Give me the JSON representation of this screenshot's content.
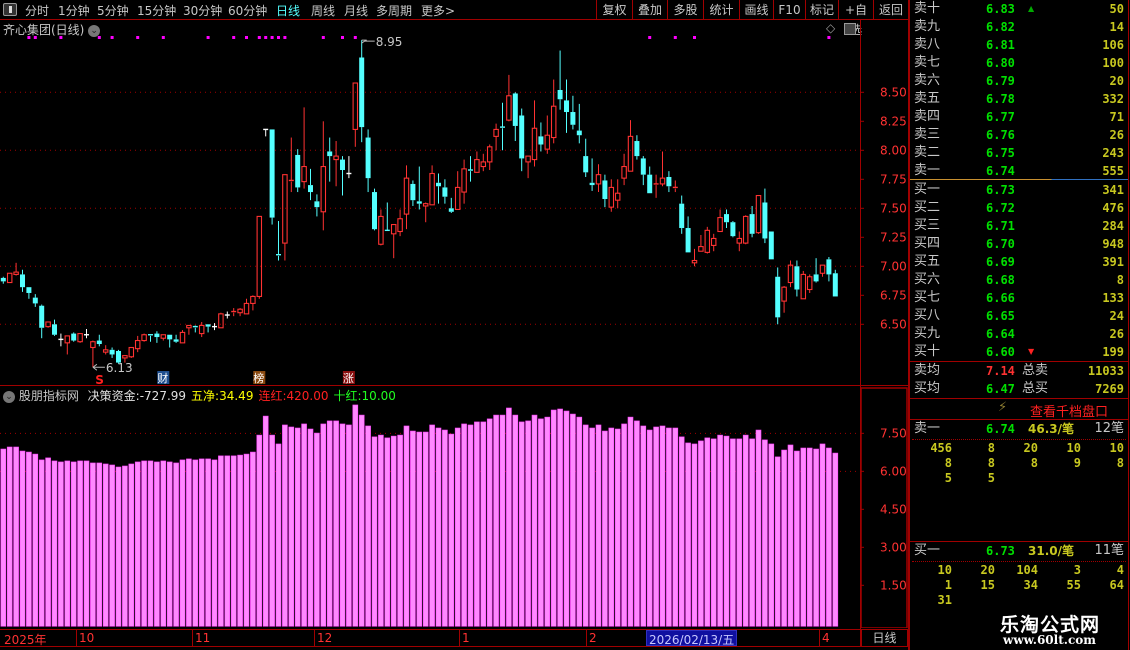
{
  "toolbar": {
    "periods": [
      {
        "label": "分时"
      },
      {
        "label": "1分钟"
      },
      {
        "label": "5分钟"
      },
      {
        "label": "15分钟"
      },
      {
        "label": "30分钟"
      },
      {
        "label": "60分钟"
      },
      {
        "label": "日线",
        "active": true
      },
      {
        "label": "周线"
      },
      {
        "label": "月线"
      },
      {
        "label": "多周期"
      },
      {
        "label": "更多>"
      }
    ],
    "buttons": [
      {
        "label": "复权"
      },
      {
        "label": "叠加"
      },
      {
        "label": "多股"
      },
      {
        "label": "统计"
      },
      {
        "label": "画线"
      },
      {
        "label": "F10"
      },
      {
        "label": "标记"
      },
      {
        "label": "+自选"
      },
      {
        "label": "返回"
      }
    ]
  },
  "chart": {
    "title": "齐心集团(日线)",
    "high_label": "8.95",
    "low_label": "6.13",
    "price_ticks": [
      "8.50",
      "8.25",
      "8.00",
      "7.75",
      "7.50",
      "7.25",
      "7.00",
      "6.75",
      "6.50"
    ],
    "markers": [
      {
        "label": "S",
        "color": "#ff2020"
      },
      {
        "label": "财",
        "color": "#1f4f8f"
      },
      {
        "label": "榜",
        "color": "#8a4a10"
      },
      {
        "label": "涨",
        "color": "#8a1010"
      }
    ]
  },
  "indicator": {
    "name": "股朋指标网",
    "fields": [
      {
        "label": "决策资金:",
        "value": "-727.99",
        "color": "#e0e0e0"
      },
      {
        "label": "五净:",
        "value": "34.49",
        "color": "#ffff00"
      },
      {
        "label": "连红:",
        "value": "420.00",
        "color": "#ff2020"
      },
      {
        "label": "十红:",
        "value": "10.00",
        "color": "#20ff20"
      }
    ],
    "ticks": [
      "7.50",
      "6.00",
      "4.50",
      "3.00",
      "1.50"
    ]
  },
  "dates": {
    "year": "2025年",
    "months": [
      "10",
      "11",
      "12",
      "1",
      "2",
      "4"
    ],
    "cursor": "2026/02/13/五",
    "period_label": "日线"
  },
  "colors": {
    "up": "#ff3232",
    "down": "#54ffff",
    "doji": "#ffffff",
    "volume": "#ff88ff",
    "grid": "#a00000",
    "signal_dot": "#ff00ff"
  },
  "chart_data": {
    "type": "candlestick",
    "ylim": [
      6.13,
      8.95
    ],
    "candles_ohlc": [
      [
        6.9,
        6.91,
        6.85,
        6.87
      ],
      [
        6.86,
        6.94,
        6.86,
        6.94
      ],
      [
        6.93,
        7.03,
        6.92,
        6.95
      ],
      [
        6.93,
        6.97,
        6.78,
        6.82
      ],
      [
        6.82,
        6.82,
        6.72,
        6.77
      ],
      [
        6.73,
        6.76,
        6.65,
        6.68
      ],
      [
        6.66,
        6.67,
        6.38,
        6.47
      ],
      [
        6.48,
        6.52,
        6.47,
        6.52
      ],
      [
        6.5,
        6.54,
        6.4,
        6.41
      ],
      [
        6.37,
        6.42,
        6.31,
        6.37
      ],
      [
        6.34,
        6.4,
        6.24,
        6.4
      ],
      [
        6.42,
        6.43,
        6.35,
        6.36
      ],
      [
        6.35,
        6.42,
        6.34,
        6.42
      ],
      [
        6.41,
        6.46,
        6.38,
        6.41
      ],
      [
        6.3,
        6.36,
        6.13,
        6.35
      ],
      [
        6.36,
        6.41,
        6.31,
        6.33
      ],
      [
        6.26,
        6.32,
        6.24,
        6.28
      ],
      [
        6.28,
        6.3,
        6.21,
        6.24
      ],
      [
        6.27,
        6.28,
        6.16,
        6.17
      ],
      [
        6.21,
        6.23,
        6.17,
        6.23
      ],
      [
        6.22,
        6.3,
        6.21,
        6.3
      ],
      [
        6.29,
        6.4,
        6.26,
        6.36
      ],
      [
        6.36,
        6.42,
        6.35,
        6.41
      ],
      [
        6.41,
        6.41,
        6.35,
        6.4
      ],
      [
        6.42,
        6.44,
        6.34,
        6.39
      ],
      [
        6.38,
        6.41,
        6.36,
        6.41
      ],
      [
        6.41,
        6.41,
        6.3,
        6.37
      ],
      [
        6.37,
        6.41,
        6.34,
        6.35
      ],
      [
        6.34,
        6.45,
        6.34,
        6.43
      ],
      [
        6.47,
        6.49,
        6.41,
        6.49
      ],
      [
        6.48,
        6.49,
        6.43,
        6.47
      ],
      [
        6.42,
        6.52,
        6.39,
        6.49
      ],
      [
        6.5,
        6.5,
        6.43,
        6.48
      ],
      [
        6.48,
        6.51,
        6.45,
        6.48
      ],
      [
        6.47,
        6.6,
        6.47,
        6.59
      ],
      [
        6.58,
        6.61,
        6.55,
        6.58
      ],
      [
        6.6,
        6.64,
        6.57,
        6.61
      ],
      [
        6.6,
        6.64,
        6.57,
        6.63
      ],
      [
        6.59,
        6.72,
        6.59,
        6.68
      ],
      [
        6.68,
        6.75,
        6.62,
        6.74
      ],
      [
        6.74,
        7.43,
        6.72,
        7.43
      ],
      [
        8.18,
        8.18,
        8.12,
        8.18
      ],
      [
        8.18,
        8.18,
        7.36,
        7.42
      ],
      [
        7.1,
        7.39,
        7.05,
        7.09
      ],
      [
        7.2,
        7.79,
        7.05,
        7.79
      ],
      [
        7.73,
        8.11,
        7.64,
        7.74
      ],
      [
        7.96,
        8.01,
        7.64,
        7.68
      ],
      [
        7.73,
        8.37,
        7.67,
        7.86
      ],
      [
        7.7,
        7.84,
        7.57,
        7.64
      ],
      [
        7.56,
        7.62,
        7.43,
        7.51
      ],
      [
        7.47,
        8.25,
        7.31,
        7.86
      ],
      [
        7.99,
        8.11,
        7.73,
        7.95
      ],
      [
        7.92,
        8.08,
        7.69,
        7.95
      ],
      [
        7.92,
        7.95,
        7.61,
        7.83
      ],
      [
        7.8,
        7.95,
        7.76,
        7.8
      ],
      [
        8.18,
        8.58,
        8.03,
        8.58
      ],
      [
        8.8,
        8.95,
        8.07,
        8.2
      ],
      [
        8.11,
        8.18,
        7.64,
        7.76
      ],
      [
        7.64,
        7.67,
        7.31,
        7.32
      ],
      [
        7.19,
        7.49,
        7.18,
        7.43
      ],
      [
        7.31,
        7.55,
        7.3,
        7.3
      ],
      [
        7.28,
        7.36,
        7.07,
        7.36
      ],
      [
        7.3,
        7.49,
        7.26,
        7.41
      ],
      [
        7.45,
        7.87,
        7.32,
        7.76
      ],
      [
        7.71,
        7.74,
        7.52,
        7.57
      ],
      [
        7.56,
        7.86,
        7.49,
        7.54
      ],
      [
        7.52,
        7.55,
        7.38,
        7.54
      ],
      [
        7.53,
        7.87,
        7.53,
        7.8
      ],
      [
        7.72,
        7.8,
        7.54,
        7.69
      ],
      [
        7.68,
        7.75,
        7.54,
        7.6
      ],
      [
        7.5,
        7.59,
        7.46,
        7.47
      ],
      [
        7.49,
        7.82,
        7.49,
        7.68
      ],
      [
        7.64,
        7.92,
        7.54,
        7.84
      ],
      [
        7.83,
        7.95,
        7.73,
        7.82
      ],
      [
        7.81,
        7.99,
        7.81,
        7.92
      ],
      [
        7.86,
        7.97,
        7.82,
        7.9
      ],
      [
        7.9,
        8.05,
        7.83,
        8.03
      ],
      [
        8.12,
        8.23,
        8.0,
        8.18
      ],
      [
        8.2,
        8.41,
        8.0,
        8.19
      ],
      [
        8.26,
        8.65,
        8.25,
        8.47
      ],
      [
        8.49,
        8.5,
        8.08,
        8.21
      ],
      [
        8.3,
        8.36,
        7.82,
        7.93
      ],
      [
        7.9,
        7.95,
        7.76,
        7.95
      ],
      [
        7.92,
        8.43,
        7.86,
        8.19
      ],
      [
        8.12,
        8.24,
        7.99,
        8.05
      ],
      [
        8.01,
        8.3,
        7.97,
        8.13
      ],
      [
        8.11,
        8.61,
        8.06,
        8.38
      ],
      [
        8.52,
        8.86,
        8.35,
        8.44
      ],
      [
        8.43,
        8.61,
        8.15,
        8.33
      ],
      [
        8.33,
        8.47,
        8.18,
        8.22
      ],
      [
        8.17,
        8.4,
        8.06,
        8.13
      ],
      [
        7.95,
        8.1,
        7.77,
        7.81
      ],
      [
        7.72,
        7.93,
        7.65,
        7.7
      ],
      [
        7.71,
        7.88,
        7.64,
        7.79
      ],
      [
        7.74,
        7.79,
        7.51,
        7.58
      ],
      [
        7.51,
        7.75,
        7.47,
        7.68
      ],
      [
        7.57,
        7.75,
        7.5,
        7.63
      ],
      [
        7.76,
        7.97,
        7.7,
        7.86
      ],
      [
        7.82,
        8.26,
        7.82,
        8.12
      ],
      [
        8.08,
        8.13,
        7.92,
        7.95
      ],
      [
        7.93,
        7.95,
        7.7,
        7.79
      ],
      [
        7.79,
        7.86,
        7.63,
        7.63
      ],
      [
        7.7,
        7.79,
        7.59,
        7.71
      ],
      [
        7.71,
        7.99,
        7.69,
        7.76
      ],
      [
        7.77,
        7.82,
        7.64,
        7.69
      ],
      [
        7.67,
        7.74,
        7.64,
        7.68
      ],
      [
        7.54,
        7.61,
        7.28,
        7.33
      ],
      [
        7.33,
        7.43,
        7.12,
        7.12
      ],
      [
        7.03,
        7.15,
        7.0,
        7.05
      ],
      [
        7.13,
        7.27,
        7.13,
        7.17
      ],
      [
        7.12,
        7.34,
        7.11,
        7.31
      ],
      [
        7.18,
        7.28,
        7.13,
        7.24
      ],
      [
        7.3,
        7.49,
        7.3,
        7.42
      ],
      [
        7.45,
        7.49,
        7.33,
        7.38
      ],
      [
        7.38,
        7.39,
        7.25,
        7.26
      ],
      [
        7.2,
        7.3,
        7.13,
        7.24
      ],
      [
        7.2,
        7.44,
        7.19,
        7.43
      ],
      [
        7.45,
        7.52,
        7.25,
        7.28
      ],
      [
        7.29,
        7.61,
        7.28,
        7.61
      ],
      [
        7.55,
        7.67,
        7.2,
        7.24
      ],
      [
        7.3,
        7.3,
        7.06,
        7.06
      ],
      [
        6.91,
        6.99,
        6.5,
        6.56
      ],
      [
        6.7,
        6.83,
        6.6,
        6.82
      ],
      [
        6.86,
        7.05,
        6.82,
        7.01
      ],
      [
        7.0,
        7.05,
        6.74,
        6.8
      ],
      [
        6.72,
        6.96,
        6.72,
        6.93
      ],
      [
        6.8,
        6.93,
        6.77,
        6.91
      ],
      [
        6.93,
        7.07,
        6.86,
        6.87
      ],
      [
        6.94,
        7.01,
        6.91,
        7.01
      ],
      [
        7.06,
        7.08,
        6.87,
        6.93
      ],
      [
        6.94,
        6.97,
        6.74,
        6.74
      ]
    ],
    "indicator_values": [
      6.88,
      6.96,
      6.96,
      6.8,
      6.76,
      6.68,
      6.45,
      6.53,
      6.41,
      6.37,
      6.41,
      6.37,
      6.41,
      6.41,
      6.33,
      6.33,
      6.29,
      6.25,
      6.17,
      6.21,
      6.29,
      6.37,
      6.41,
      6.41,
      6.37,
      6.41,
      6.37,
      6.33,
      6.45,
      6.49,
      6.45,
      6.49,
      6.49,
      6.45,
      6.61,
      6.61,
      6.61,
      6.64,
      6.68,
      6.76,
      7.43,
      8.18,
      7.43,
      7.08,
      7.83,
      7.75,
      7.71,
      7.87,
      7.67,
      7.51,
      7.87,
      7.99,
      7.99,
      7.87,
      7.83,
      8.62,
      8.22,
      7.79,
      7.36,
      7.43,
      7.32,
      7.39,
      7.43,
      7.79,
      7.59,
      7.55,
      7.55,
      7.83,
      7.71,
      7.63,
      7.47,
      7.71,
      7.87,
      7.83,
      7.95,
      7.95,
      8.07,
      8.22,
      8.22,
      8.5,
      8.22,
      7.95,
      7.99,
      8.22,
      8.07,
      8.14,
      8.42,
      8.46,
      8.38,
      8.26,
      8.14,
      7.83,
      7.71,
      7.83,
      7.59,
      7.71,
      7.67,
      7.87,
      8.14,
      7.99,
      7.79,
      7.63,
      7.75,
      7.79,
      7.71,
      7.71,
      7.36,
      7.12,
      7.08,
      7.2,
      7.32,
      7.28,
      7.43,
      7.39,
      7.28,
      7.28,
      7.43,
      7.28,
      7.63,
      7.24,
      7.08,
      6.57,
      6.84,
      7.04,
      6.8,
      6.92,
      6.92,
      6.88,
      7.08,
      6.92,
      6.72
    ],
    "indicator_ylim": [
      0,
      8.5
    ],
    "signal_dot_indices": [
      4,
      5,
      9,
      15,
      17,
      21,
      25,
      32,
      36,
      38,
      40,
      41,
      42,
      43,
      44,
      50,
      53,
      55,
      101,
      105,
      108,
      129
    ],
    "high_index": 56,
    "low_index": 14,
    "marker_indices": [
      15,
      25,
      40,
      54
    ]
  },
  "orderbook": {
    "asks": [
      {
        "label": "卖十",
        "price": "6.83",
        "vol": "50",
        "mark": "up"
      },
      {
        "label": "卖九",
        "price": "6.82",
        "vol": "14"
      },
      {
        "label": "卖八",
        "price": "6.81",
        "vol": "106"
      },
      {
        "label": "卖七",
        "price": "6.80",
        "vol": "100"
      },
      {
        "label": "卖六",
        "price": "6.79",
        "vol": "20"
      },
      {
        "label": "卖五",
        "price": "6.78",
        "vol": "332"
      },
      {
        "label": "卖四",
        "price": "6.77",
        "vol": "71"
      },
      {
        "label": "卖三",
        "price": "6.76",
        "vol": "26"
      },
      {
        "label": "卖二",
        "price": "6.75",
        "vol": "243"
      },
      {
        "label": "卖一",
        "price": "6.74",
        "vol": "555"
      }
    ],
    "bids": [
      {
        "label": "买一",
        "price": "6.73",
        "vol": "341"
      },
      {
        "label": "买二",
        "price": "6.72",
        "vol": "476"
      },
      {
        "label": "买三",
        "price": "6.71",
        "vol": "284"
      },
      {
        "label": "买四",
        "price": "6.70",
        "vol": "948"
      },
      {
        "label": "买五",
        "price": "6.69",
        "vol": "391"
      },
      {
        "label": "买六",
        "price": "6.68",
        "vol": "8"
      },
      {
        "label": "买七",
        "price": "6.66",
        "vol": "133"
      },
      {
        "label": "买八",
        "price": "6.65",
        "vol": "24"
      },
      {
        "label": "买九",
        "price": "6.64",
        "vol": "26"
      },
      {
        "label": "买十",
        "price": "6.60",
        "vol": "199",
        "mark": "down"
      }
    ],
    "avg_sell": {
      "label": "卖均",
      "price": "7.14",
      "total_label": "总卖",
      "total": "11033"
    },
    "avg_buy": {
      "label": "买均",
      "price": "6.47",
      "total_label": "总买",
      "total": "7269"
    },
    "depth_link": "查看千档盘口",
    "ask1_detail": {
      "label": "卖一",
      "price": "6.74",
      "avg": "46.3/笔",
      "count": "12笔",
      "orders": [
        "456",
        "8",
        "20",
        "10",
        "10",
        "8",
        "8",
        "8",
        "9",
        "8",
        "5",
        "5"
      ]
    },
    "bid1_detail": {
      "label": "买一",
      "price": "6.73",
      "avg": "31.0/笔",
      "count": "11笔",
      "orders": [
        "10",
        "20",
        "104",
        "3",
        "4",
        "1",
        "15",
        "34",
        "55",
        "64",
        "31"
      ]
    }
  },
  "watermark": {
    "name": "乐淘公式网",
    "url": "www.60lt.com"
  }
}
